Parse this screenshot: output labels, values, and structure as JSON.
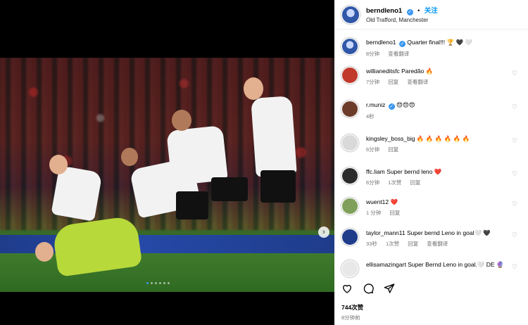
{
  "post": {
    "username": "berndleno1",
    "follow_label": "关注",
    "location": "Old Trafford, Manchester",
    "likes": "744次赞",
    "time": "8分钟前",
    "carousel": {
      "slide_count": 6,
      "active_index": 0
    }
  },
  "caption": {
    "username": "berndleno1",
    "text": "Quarter final!!! 🏆 🖤 🤍",
    "age": "8分钟",
    "reply_label": "回复",
    "translate_label": "查看翻译"
  },
  "comments": [
    {
      "username": "willianeditsfc",
      "text": "Paredão 🔥",
      "age": "7分钟",
      "likes": "",
      "reply": "回复",
      "translate": "查看翻译",
      "avatar_color": "#c0392b"
    },
    {
      "username": "r.muniz",
      "verified": true,
      "text": "😍😍😍",
      "age": "4秒",
      "likes": "",
      "reply": "",
      "translate": "",
      "avatar_color": "#6d3b2a"
    },
    {
      "username": "kingsley_boss_big",
      "text": "🔥 🔥 🔥 🔥 🔥 🔥",
      "age": "6分钟",
      "likes": "",
      "reply": "回复",
      "translate": "",
      "avatar_color": "#d9d9d9"
    },
    {
      "username": "ffc.liam",
      "text": "Super bernd leno ❤️",
      "age": "6分钟",
      "likes": "1次赞",
      "reply": "回复",
      "translate": "",
      "avatar_color": "#2b2b2b"
    },
    {
      "username": "wuent12",
      "text": "❤️",
      "age": "1 分钟",
      "likes": "",
      "reply": "回复",
      "translate": "",
      "avatar_color": "#7fa05a"
    },
    {
      "username": "taylor_mann11",
      "text": "Super bernd Leno in goal🤍 🖤",
      "age": "33秒",
      "likes": "1次赞",
      "reply": "回复",
      "translate": "查看翻译",
      "avatar_color": "#1f3c8a"
    },
    {
      "username": "ellisamazingart",
      "text": "Super Bernd Leno in goal.🤍 DE 🔮",
      "age": "",
      "likes": "",
      "reply": "",
      "translate": "",
      "avatar_color": "#e8e8e8"
    }
  ],
  "colors": {
    "link": "#0095f6",
    "muted": "#737373"
  },
  "icons": [
    "heart-icon",
    "comment-icon",
    "share-icon",
    "chevron-right-icon",
    "verified-icon"
  ]
}
